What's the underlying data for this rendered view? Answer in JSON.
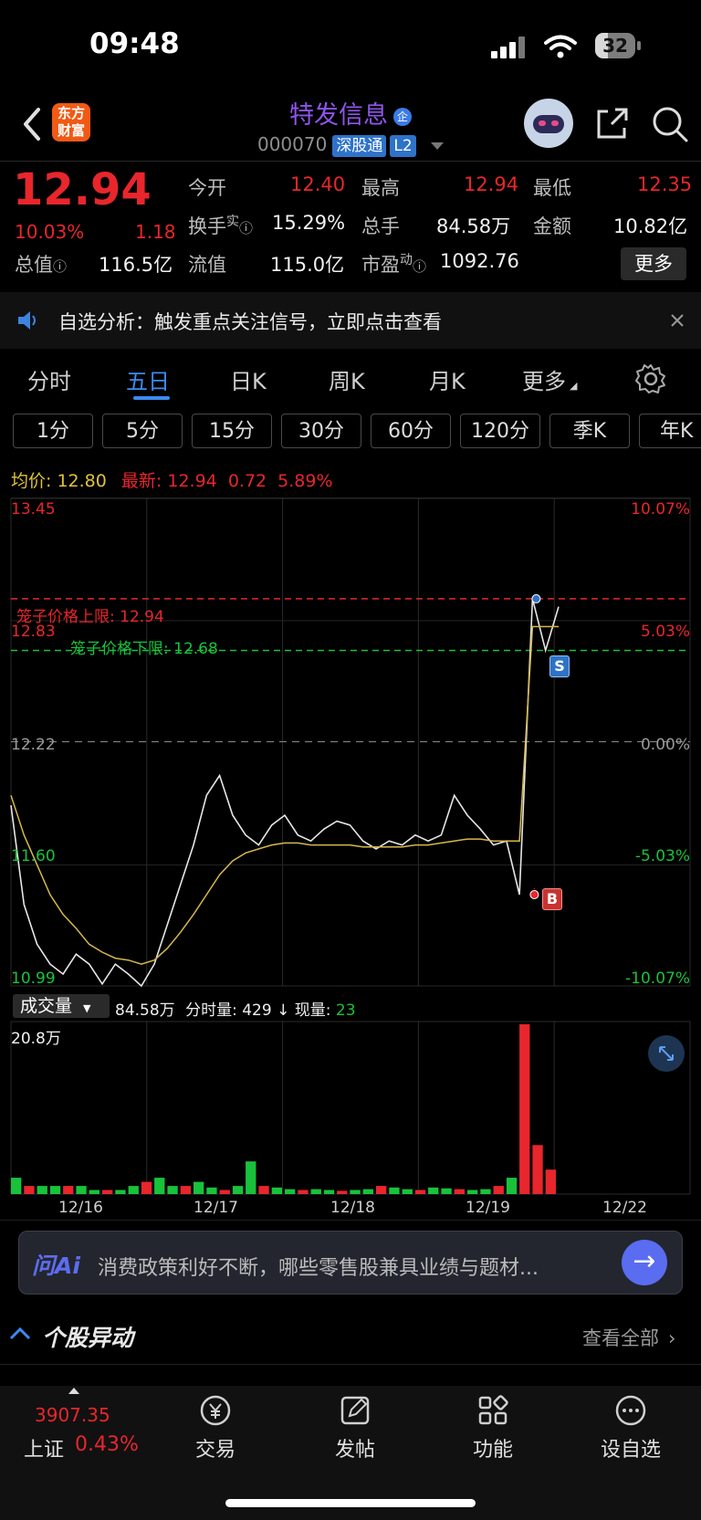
{
  "status": {
    "time": "09:48",
    "battery": "32",
    "battery_level": 0.32
  },
  "header": {
    "logo_text": "东方\n财富",
    "stock_name": "特发信息",
    "badge_qi": "企",
    "code": "000070",
    "tag1": "深股通",
    "tag2": "L2"
  },
  "quote": {
    "price": "12.94",
    "pct": "10.03%",
    "change": "1.18",
    "labels": {
      "open": "今开",
      "high": "最高",
      "low": "最低",
      "turnover": "换手",
      "turnover_sup": "实",
      "volume": "总手",
      "amount": "金额",
      "mktcap": "总值",
      "float": "流值",
      "pe": "市盈",
      "pe_sup": "动"
    },
    "values": {
      "open": "12.40",
      "high": "12.94",
      "low": "12.35",
      "turnover": "15.29%",
      "volume": "84.58万",
      "amount": "10.82亿",
      "mktcap": "116.5亿",
      "float": "115.0亿",
      "pe": "1092.76"
    },
    "more": "更多"
  },
  "notice": {
    "text": "自选分析：触发重点关注信号，立即点击查看"
  },
  "tabs": {
    "items": [
      "分时",
      "五日",
      "日K",
      "周K",
      "月K",
      "更多"
    ],
    "active": "五日"
  },
  "periods": [
    "1分",
    "5分",
    "15分",
    "30分",
    "60分",
    "120分",
    "季K",
    "年K"
  ],
  "summary": {
    "avg_label": "均价:",
    "avg": "12.80",
    "latest_label": "最新:",
    "latest": "12.94",
    "chg": "0.72",
    "chg_pct": "5.89%"
  },
  "chart": {
    "y_left": [
      "13.45",
      "12.83",
      "12.22",
      "11.60",
      "10.99"
    ],
    "y_right": [
      "10.07%",
      "5.03%",
      "0.00%",
      "-5.03%",
      "-10.07%"
    ],
    "upper_limit_label": "笼子价格上限: 12.94",
    "lower_limit_label": "笼子价格下限: 12.68",
    "sell_mark": "S",
    "buy_mark": "B"
  },
  "volume": {
    "selector": "成交量",
    "total": "84.58万",
    "tick_label": "分时量:",
    "tick": "429",
    "tick_arrow": "↓",
    "now_label": "现量:",
    "now": "23",
    "ymax": "20.8万"
  },
  "dates": [
    "12/16",
    "12/17",
    "12/18",
    "12/19",
    "12/22"
  ],
  "ai": {
    "brand": "问Ai",
    "text": "消费政策利好不断，哪些零售股兼具业绩与题材..."
  },
  "movers": {
    "title": "个股异动",
    "view_all": "查看全部"
  },
  "bottom": {
    "index_value": "3907.35",
    "index_name": "上证",
    "index_pct": "0.43%",
    "items": [
      "交易",
      "发帖",
      "功能",
      "设自选"
    ]
  },
  "chart_data": {
    "type": "line",
    "title": "",
    "x": [
      "12/16",
      "12/17",
      "12/18",
      "12/19",
      "12/22"
    ],
    "ylim": [
      10.99,
      13.45
    ],
    "base": 12.22,
    "series": [
      {
        "values": [
          11.9,
          11.4,
          11.2,
          11.1,
          11.05,
          11.15,
          11.1,
          11.0,
          11.1,
          11.05,
          10.99,
          11.1,
          11.3,
          11.5,
          11.7,
          11.95,
          12.05,
          11.85,
          11.75,
          11.7,
          11.8,
          11.85,
          11.75,
          11.72,
          11.78,
          11.82,
          11.8,
          11.72,
          11.68,
          11.72,
          11.7,
          11.75,
          11.72,
          11.75,
          11.95,
          11.85,
          11.78,
          11.7,
          11.72,
          11.45,
          12.94,
          12.68,
          12.9
        ]
      },
      {
        "values": [
          11.95,
          11.75,
          11.6,
          11.45,
          11.35,
          11.28,
          11.2,
          11.16,
          11.13,
          11.12,
          11.1,
          11.12,
          11.18,
          11.26,
          11.35,
          11.45,
          11.55,
          11.62,
          11.66,
          11.68,
          11.7,
          11.71,
          11.71,
          11.7,
          11.7,
          11.7,
          11.7,
          11.69,
          11.69,
          11.69,
          11.69,
          11.7,
          11.7,
          11.71,
          11.72,
          11.73,
          11.73,
          11.72,
          11.72,
          11.72,
          12.8,
          12.8,
          12.8
        ]
      }
    ],
    "volume_ymax": "20.8万",
    "volume": [
      2,
      1,
      1,
      1,
      1,
      1,
      0.5,
      0.5,
      0.5,
      1,
      1.5,
      2,
      1,
      1,
      1.5,
      0.8,
      0.5,
      1,
      4,
      1,
      0.8,
      0.6,
      0.5,
      0.6,
      0.5,
      0.4,
      0.5,
      0.6,
      1,
      0.8,
      0.6,
      0.5,
      0.8,
      0.7,
      0.6,
      0.5,
      0.6,
      1,
      2,
      20.8,
      6,
      3
    ]
  }
}
